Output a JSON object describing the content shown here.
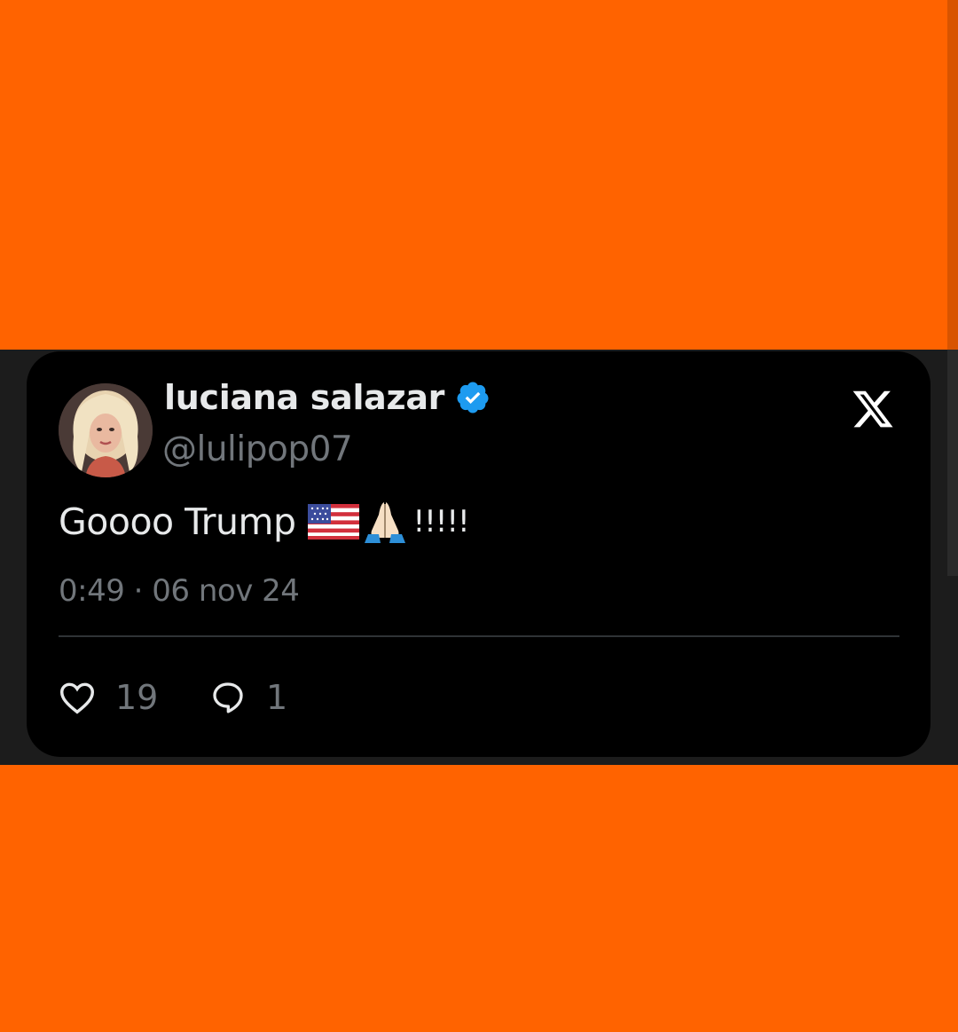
{
  "tweet": {
    "display_name": "luciana salazar",
    "handle": "@lulipop07",
    "text": "Goooo Trump",
    "text_suffix": "!!!!!",
    "emojis": [
      "us-flag-icon",
      "folded-hands-icon"
    ],
    "timestamp": "0:49 · 06 nov 24",
    "likes": "19",
    "replies": "1",
    "verified": true
  },
  "colors": {
    "background": "#ff6300",
    "card": "#000000",
    "verified_badge": "#1d9bf0",
    "primary_text": "#e7e9ea",
    "secondary_text": "#71767b"
  }
}
